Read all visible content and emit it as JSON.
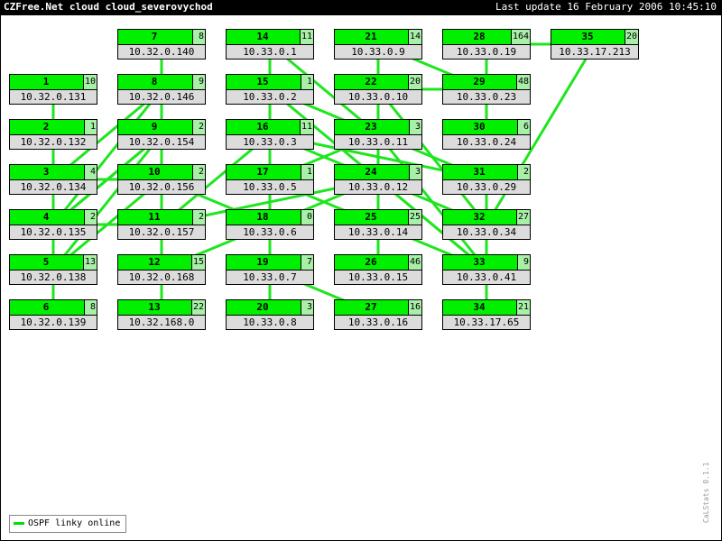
{
  "header": {
    "title": "CZFree.Net cloud cloud_severovychod",
    "last_update": "Last update 16 February 2006 10:45:10"
  },
  "nodes": [
    {
      "id": "1",
      "count": "10",
      "ip": "10.32.0.131"
    },
    {
      "id": "2",
      "count": "1",
      "ip": "10.32.0.132"
    },
    {
      "id": "3",
      "count": "4",
      "ip": "10.32.0.134"
    },
    {
      "id": "4",
      "count": "2",
      "ip": "10.32.0.135"
    },
    {
      "id": "5",
      "count": "13",
      "ip": "10.32.0.138"
    },
    {
      "id": "6",
      "count": "8",
      "ip": "10.32.0.139"
    },
    {
      "id": "7",
      "count": "8",
      "ip": "10.32.0.140"
    },
    {
      "id": "8",
      "count": "9",
      "ip": "10.32.0.146"
    },
    {
      "id": "9",
      "count": "2",
      "ip": "10.32.0.154"
    },
    {
      "id": "10",
      "count": "2",
      "ip": "10.32.0.156"
    },
    {
      "id": "11",
      "count": "2",
      "ip": "10.32.0.157"
    },
    {
      "id": "12",
      "count": "15",
      "ip": "10.32.0.168"
    },
    {
      "id": "13",
      "count": "22",
      "ip": "10.32.168.0"
    },
    {
      "id": "14",
      "count": "11",
      "ip": "10.33.0.1"
    },
    {
      "id": "15",
      "count": "1",
      "ip": "10.33.0.2"
    },
    {
      "id": "16",
      "count": "11",
      "ip": "10.33.0.3"
    },
    {
      "id": "17",
      "count": "1",
      "ip": "10.33.0.5"
    },
    {
      "id": "18",
      "count": "0",
      "ip": "10.33.0.6"
    },
    {
      "id": "19",
      "count": "7",
      "ip": "10.33.0.7"
    },
    {
      "id": "20",
      "count": "3",
      "ip": "10.33.0.8"
    },
    {
      "id": "21",
      "count": "14",
      "ip": "10.33.0.9"
    },
    {
      "id": "22",
      "count": "20",
      "ip": "10.33.0.10"
    },
    {
      "id": "23",
      "count": "3",
      "ip": "10.33.0.11"
    },
    {
      "id": "24",
      "count": "3",
      "ip": "10.33.0.12"
    },
    {
      "id": "25",
      "count": "25",
      "ip": "10.33.0.14"
    },
    {
      "id": "26",
      "count": "46",
      "ip": "10.33.0.15"
    },
    {
      "id": "27",
      "count": "16",
      "ip": "10.33.0.16"
    },
    {
      "id": "28",
      "count": "164",
      "ip": "10.33.0.19"
    },
    {
      "id": "29",
      "count": "48",
      "ip": "10.33.0.23"
    },
    {
      "id": "30",
      "count": "6",
      "ip": "10.33.0.24"
    },
    {
      "id": "31",
      "count": "2",
      "ip": "10.33.0.29"
    },
    {
      "id": "32",
      "count": "27",
      "ip": "10.33.0.34"
    },
    {
      "id": "33",
      "count": "9",
      "ip": "10.33.0.41"
    },
    {
      "id": "34",
      "count": "21",
      "ip": "10.33.17.65"
    },
    {
      "id": "35",
      "count": "20",
      "ip": "10.33.17.213"
    }
  ],
  "links": [
    [
      "1",
      "2"
    ],
    [
      "2",
      "3"
    ],
    [
      "3",
      "4"
    ],
    [
      "4",
      "5"
    ],
    [
      "5",
      "6"
    ],
    [
      "3",
      "10"
    ],
    [
      "4",
      "11"
    ],
    [
      "4",
      "8"
    ],
    [
      "4",
      "9"
    ],
    [
      "5",
      "9"
    ],
    [
      "5",
      "10"
    ],
    [
      "3",
      "8"
    ],
    [
      "5",
      "4"
    ],
    [
      "7",
      "8"
    ],
    [
      "8",
      "9"
    ],
    [
      "9",
      "10"
    ],
    [
      "9",
      "4"
    ],
    [
      "10",
      "11"
    ],
    [
      "11",
      "12"
    ],
    [
      "12",
      "13"
    ],
    [
      "11",
      "13"
    ],
    [
      "12",
      "18"
    ],
    [
      "10",
      "18"
    ],
    [
      "11",
      "16"
    ],
    [
      "11",
      "24"
    ],
    [
      "14",
      "15"
    ],
    [
      "15",
      "16"
    ],
    [
      "16",
      "17"
    ],
    [
      "17",
      "18"
    ],
    [
      "18",
      "19"
    ],
    [
      "19",
      "20"
    ],
    [
      "19",
      "27"
    ],
    [
      "17",
      "25"
    ],
    [
      "16",
      "24"
    ],
    [
      "16",
      "31"
    ],
    [
      "15",
      "23"
    ],
    [
      "14",
      "23"
    ],
    [
      "15",
      "33"
    ],
    [
      "17",
      "23"
    ],
    [
      "18",
      "24"
    ],
    [
      "21",
      "22"
    ],
    [
      "22",
      "23"
    ],
    [
      "23",
      "24"
    ],
    [
      "24",
      "25"
    ],
    [
      "25",
      "26"
    ],
    [
      "22",
      "24"
    ],
    [
      "22",
      "29"
    ],
    [
      "21",
      "29"
    ],
    [
      "23",
      "31"
    ],
    [
      "24",
      "32"
    ],
    [
      "24",
      "33"
    ],
    [
      "25",
      "33"
    ],
    [
      "22",
      "32"
    ],
    [
      "23",
      "33"
    ],
    [
      "28",
      "29"
    ],
    [
      "28",
      "35"
    ],
    [
      "29",
      "30"
    ],
    [
      "31",
      "32"
    ],
    [
      "32",
      "33"
    ],
    [
      "33",
      "34"
    ],
    [
      "32",
      "34"
    ],
    [
      "35",
      "32"
    ]
  ],
  "colors": {
    "header_bg": "#000000",
    "node_head": "#00f000",
    "node_count_bg": "#a8f0a8",
    "node_body": "#dcdcdc",
    "link": "#1ee61e"
  },
  "legend": {
    "label": "OSPF linky online"
  },
  "watermark": "CaLStats 0.1.1"
}
